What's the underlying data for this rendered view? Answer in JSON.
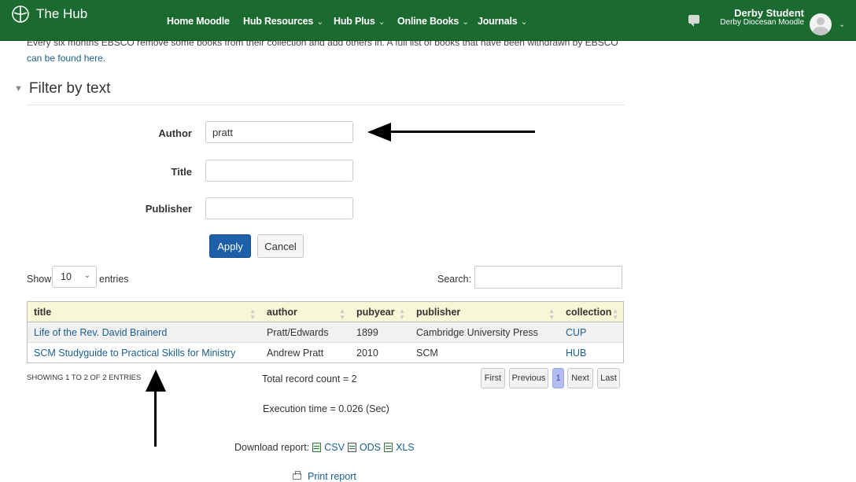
{
  "navbar": {
    "brand": "The Hub",
    "links": [
      {
        "label": "Home Moodle",
        "has_menu": false
      },
      {
        "label": "Hub Resources",
        "has_menu": true
      },
      {
        "label": "Hub Plus",
        "has_menu": true
      },
      {
        "label": "Online Books",
        "has_menu": true
      },
      {
        "label": "Journals",
        "has_menu": true
      }
    ],
    "user_name": "Derby Student",
    "user_site": "Derby Diocesan Moodle",
    "icons": [
      "brand-cross-icon",
      "message-icon",
      "avatar",
      "chevron-down-icon"
    ],
    "colors": {
      "bar": "#1b6a2f"
    }
  },
  "intro": {
    "text": "Every six months EBSCO remove some books from their collection and add others in. A full list of books that have been withdrawn by EBSCO",
    "link": "can be found here."
  },
  "filter": {
    "heading": "Filter by text",
    "author_label": "Author",
    "author_value": "pratt",
    "title_label": "Title",
    "title_value": "",
    "publisher_label": "Publisher",
    "publisher_value": "",
    "apply_label": "Apply",
    "cancel_label": "Cancel"
  },
  "table_controls": {
    "show_label": "Show",
    "entries_value": "10",
    "entries_label": "entries",
    "search_label": "Search:",
    "search_value": ""
  },
  "table": {
    "columns": [
      "title",
      "author",
      "pubyear",
      "publisher",
      "collection"
    ],
    "rows": [
      {
        "title": "Life of the Rev. David Brainerd",
        "author": "Pratt/Edwards",
        "pubyear": "1899",
        "publisher": "Cambridge University Press",
        "collection": "CUP"
      },
      {
        "title": "SCM Studyguide to Practical Skills for Ministry",
        "author": "Andrew Pratt",
        "pubyear": "2010",
        "publisher": "SCM",
        "collection": "HUB"
      }
    ]
  },
  "footer": {
    "showing": "SHOWING 1 TO 2 OF 2 ENTRIES",
    "total": "Total record count = 2",
    "pagination": {
      "first": "First",
      "previous": "Previous",
      "current": "1",
      "next": "Next",
      "last": "Last"
    },
    "execution": "Execution time = 0.026 (Sec)",
    "download_label": "Download report:",
    "download_csv": "CSV",
    "download_ods": "ODS",
    "download_xls": "XLS",
    "print_label": "Print report"
  }
}
